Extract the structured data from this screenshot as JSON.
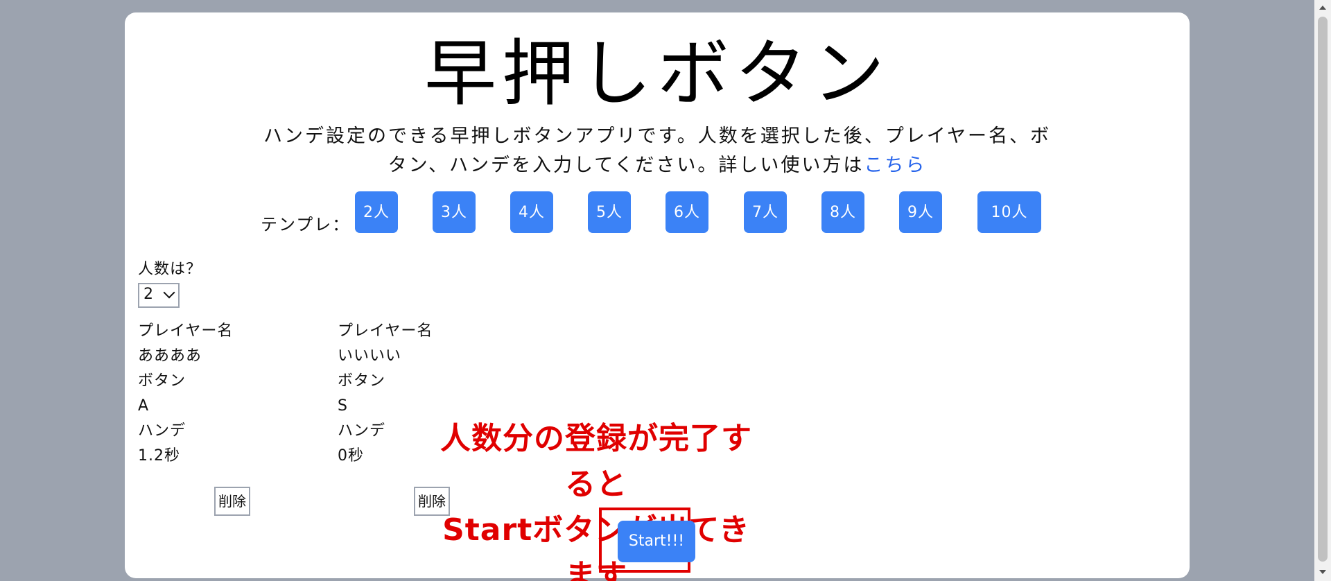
{
  "app": {
    "title": "早押しボタン",
    "description_main": "ハンデ設定のできる早押しボタンアプリです。人数を選択した後、プレイヤー名、ボタン、ハンデを入力してください。詳しい使い方は",
    "description_link": "こちら"
  },
  "templates": {
    "label": "テンプレ：",
    "buttons": [
      "2人",
      "3人",
      "4人",
      "5人",
      "6人",
      "7人",
      "8人",
      "9人",
      "10人"
    ]
  },
  "count": {
    "label": "人数は？",
    "selected": "2"
  },
  "players": [
    {
      "name_label": "プレイヤー名",
      "name": "ああああ",
      "button_label": "ボタン",
      "button": "A",
      "handicap_label": "ハンデ",
      "handicap": "1.2秒",
      "delete_label": "削除"
    },
    {
      "name_label": "プレイヤー名",
      "name": "いいいい",
      "button_label": "ボタン",
      "button": "S",
      "handicap_label": "ハンデ",
      "handicap": "0秒",
      "delete_label": "削除"
    }
  ],
  "note": {
    "line1": "人数分の登録が完了すると",
    "line2": "Startボタンが出てきます",
    "color": "#e00000"
  },
  "start": {
    "label": "Start!!!"
  },
  "colors": {
    "accent": "#3b82f6",
    "background": "#9ca3af",
    "link": "#2563eb"
  }
}
